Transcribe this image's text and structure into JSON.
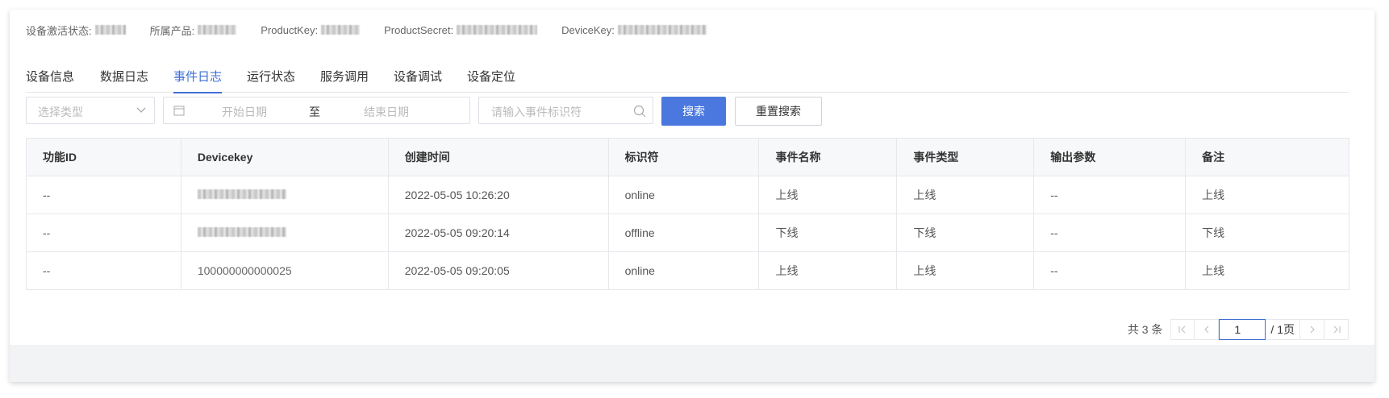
{
  "info": {
    "status_label": "设备激活状态:",
    "product_label": "所属产品:",
    "productkey_label": "ProductKey:",
    "productsecret_label": "ProductSecret:",
    "devicekey_label": "DeviceKey:"
  },
  "tabs": [
    "设备信息",
    "数据日志",
    "事件日志",
    "运行状态",
    "服务调用",
    "设备调试",
    "设备定位"
  ],
  "active_tab": "事件日志",
  "filters": {
    "type_placeholder": "选择类型",
    "start_placeholder": "开始日期",
    "range_separator": "至",
    "end_placeholder": "结束日期",
    "search_placeholder": "请输入事件标识符",
    "search_button": "搜索",
    "reset_button": "重置搜索"
  },
  "table": {
    "headers": [
      "功能ID",
      "Devicekey",
      "创建时间",
      "标识符",
      "事件名称",
      "事件类型",
      "输出参数",
      "备注"
    ],
    "rows": [
      [
        "--",
        "",
        "2022-05-05 10:26:20",
        "online",
        "上线",
        "上线",
        "--",
        "上线"
      ],
      [
        "--",
        "",
        "2022-05-05 09:20:14",
        "offline",
        "下线",
        "下线",
        "--",
        "下线"
      ],
      [
        "--",
        "100000000000025",
        "2022-05-05 09:20:05",
        "online",
        "上线",
        "上线",
        "--",
        "上线"
      ]
    ]
  },
  "pagination": {
    "total_text": "共 3 条",
    "current_page": "1",
    "total_pages": "/ 1页"
  },
  "colors": {
    "accent": "#3f6fd5",
    "primary_button": "#4a78de"
  }
}
